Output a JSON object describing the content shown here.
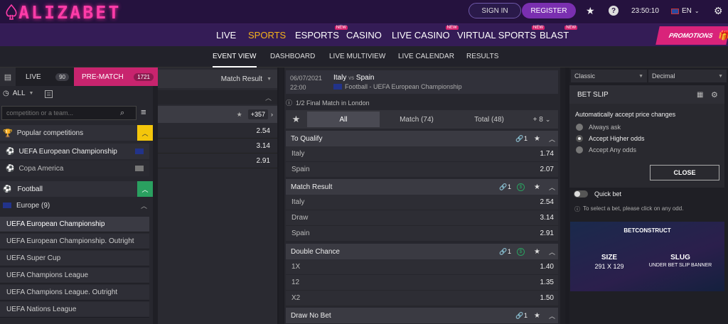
{
  "header": {
    "logo": "ALIZABET",
    "sign_in": "SIGN IN",
    "register": "REGISTER",
    "time": "23:50:10",
    "language": "EN"
  },
  "nav": {
    "items": [
      {
        "label": "LIVE",
        "new": ""
      },
      {
        "label": "SPORTS",
        "new": ""
      },
      {
        "label": "ESPORTS",
        "new": "NEW"
      },
      {
        "label": "CASINO",
        "new": ""
      },
      {
        "label": "LIVE CASINO",
        "new": "NEW"
      },
      {
        "label": "VIRTUAL SPORTS",
        "new": "NEW"
      },
      {
        "label": "BLAST",
        "new": "NEW"
      }
    ],
    "promotions": "PROMOTIONS"
  },
  "subnav": [
    "EVENT VIEW",
    "DASHBOARD",
    "LIVE MULTIVIEW",
    "LIVE CALENDAR",
    "RESULTS"
  ],
  "left": {
    "live_tab": "LIVE",
    "live_count": "90",
    "prematch_tab": "PRE-MATCH",
    "prematch_count": "1721",
    "filter_all": "ALL",
    "search_placeholder": "competition or a team...",
    "popular_title": "Popular competitions",
    "popular": [
      "UEFA European Championship",
      "Copa America"
    ],
    "sport": "Football",
    "region": "Europe (9)",
    "competitions": [
      "UEFA European Championship",
      "UEFA European Championship. Outright",
      "UEFA Super Cup",
      "UEFA Champions League",
      "UEFA Champions League. Outright",
      "UEFA Nations League"
    ]
  },
  "middle": {
    "market_select": "Match Result",
    "more": "+357",
    "odds": [
      "2.54",
      "3.14",
      "2.91"
    ]
  },
  "event": {
    "date": "06/07/2021",
    "time": "22:00",
    "home": "Italy",
    "vs": "vs",
    "away": "Spain",
    "competition": "Football - UEFA European Championship",
    "info": "1/2 Final Match in London",
    "tabs": {
      "all": "All",
      "match": "Match (74)",
      "total": "Total (48)",
      "more": "+ 8"
    }
  },
  "markets": [
    {
      "name": "To Qualify",
      "count": "1",
      "outcomes": [
        [
          "Italy",
          "1.74"
        ],
        [
          "Spain",
          "2.07"
        ]
      ]
    },
    {
      "name": "Match Result",
      "count": "1",
      "outcomes": [
        [
          "Italy",
          "2.54"
        ],
        [
          "Draw",
          "3.14"
        ],
        [
          "Spain",
          "2.91"
        ]
      ]
    },
    {
      "name": "Double Chance",
      "count": "1",
      "outcomes": [
        [
          "1X",
          "1.40"
        ],
        [
          "12",
          "1.35"
        ],
        [
          "X2",
          "1.50"
        ]
      ]
    },
    {
      "name": "Draw No Bet",
      "count": "1",
      "outcomes": []
    }
  ],
  "slip": {
    "odds_view": "Classic",
    "odds_format": "Decimal",
    "title": "BET SLIP",
    "accept_title": "Automatically accept price changes",
    "options": [
      "Always ask",
      "Accept Higher odds",
      "Accept Any odds"
    ],
    "close": "CLOSE",
    "quick_bet": "Quick bet",
    "hint": "To select a bet, please click on any odd.",
    "banner": {
      "brand": "BETCONSTRUCT",
      "size_label": "SIZE",
      "size": "291 X 129",
      "slug_label": "SLUG",
      "slug": "UNDER BET SLIP BANNER"
    }
  },
  "colors": {
    "accent": "#f6b31c",
    "brand": "#d9237a",
    "green": "#2aa060",
    "yellow": "#f4c60b"
  }
}
